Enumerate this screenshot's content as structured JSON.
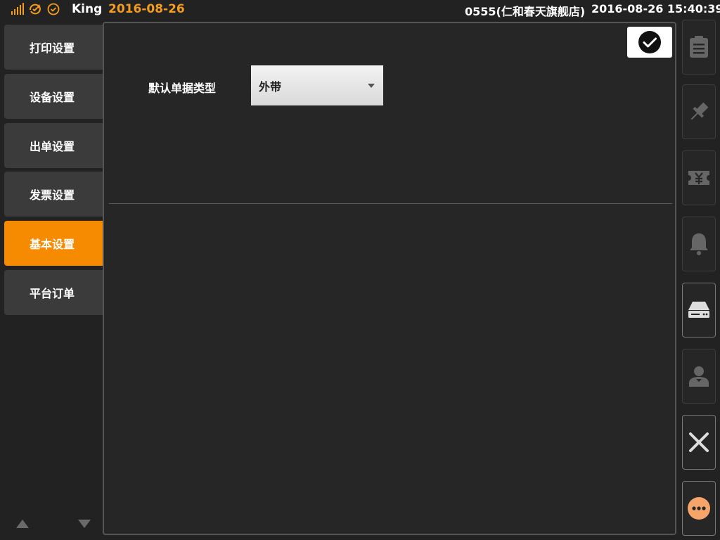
{
  "topbar": {
    "user": "King",
    "business_date": "2016-08-26",
    "store": "0555(仁和春天旗舰店)",
    "datetime": "2016-08-26 15:40:39",
    "icons": [
      "signal-icon",
      "sync-icon",
      "check-circle-icon"
    ]
  },
  "sidebar": {
    "items": [
      {
        "label": "打印设置",
        "active": false
      },
      {
        "label": "设备设置",
        "active": false
      },
      {
        "label": "出单设置",
        "active": false
      },
      {
        "label": "发票设置",
        "active": false
      },
      {
        "label": "基本设置",
        "active": true
      },
      {
        "label": "平台订单",
        "active": false
      }
    ]
  },
  "form": {
    "default_doc_type_label": "默认单据类型",
    "default_doc_type_value": "外带"
  },
  "toolbar": {
    "icons": [
      "clipboard-icon",
      "pin-icon",
      "yuan-ticket-icon",
      "bell-icon",
      "drive-icon",
      "user-icon",
      "close-icon",
      "more-icon"
    ]
  },
  "colors": {
    "accent": "#f68a00",
    "background": "#222222",
    "panel": "#262626"
  }
}
